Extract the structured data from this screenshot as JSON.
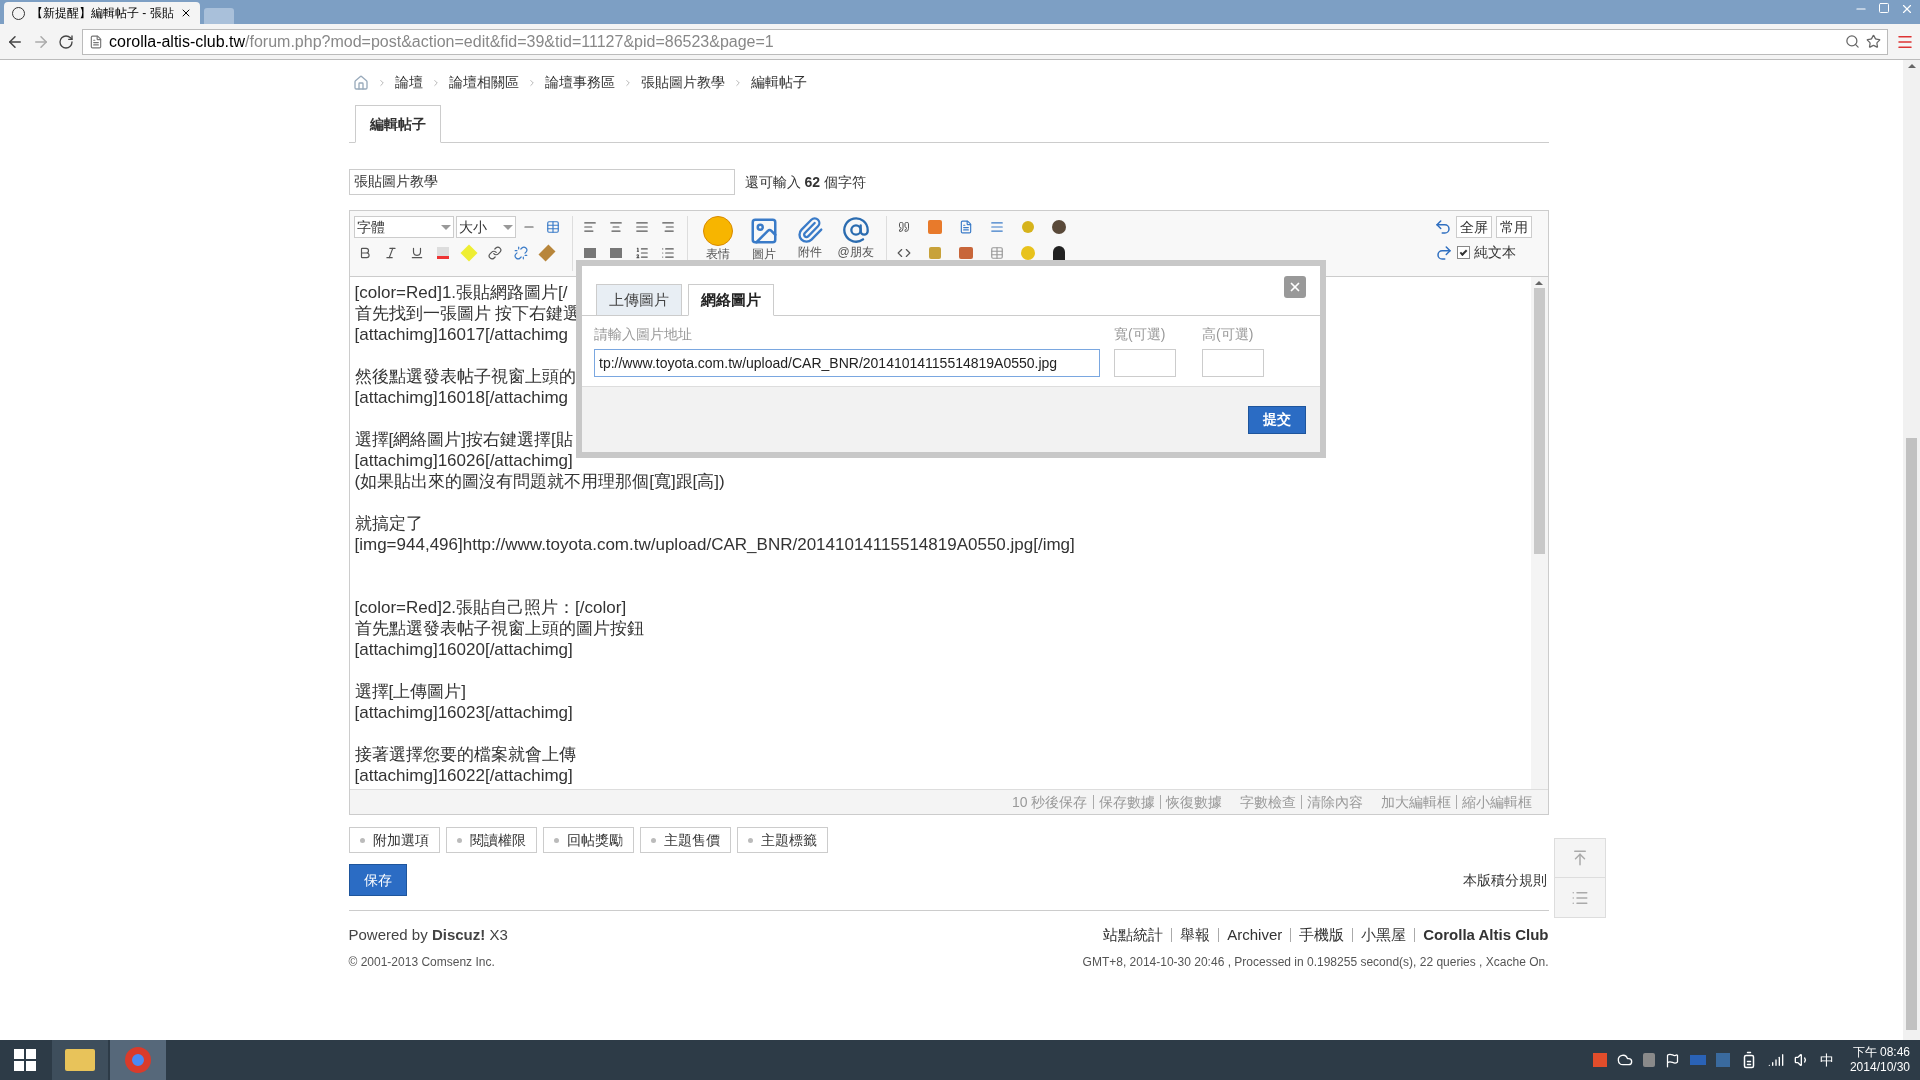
{
  "browser": {
    "tab_title": "【新提醒】編輯帖子 - 張貼",
    "url_host": "corolla-altis-club.tw",
    "url_path": "/forum.php?mod=post&action=edit&fid=39&tid=11127&pid=86523&page=1"
  },
  "breadcrumb": [
    "論壇",
    "論壇相關區",
    "論壇事務區",
    "張貼圖片教學",
    "編輯帖子"
  ],
  "page_tab": "編輯帖子",
  "subject": {
    "value": "張貼圖片教學",
    "remaining": "還可輸入 **62** 個字符"
  },
  "toolbar": {
    "font_select": "字體",
    "size_select": "大小",
    "big_buttons": [
      {
        "kind": "emoji",
        "label": "表情"
      },
      {
        "kind": "image",
        "label": "圖片"
      },
      {
        "kind": "clip",
        "label": "附件"
      },
      {
        "kind": "at",
        "label": "@朋友"
      }
    ],
    "fullscreen": "全屏",
    "common": "常用",
    "plain_text": {
      "label": "純文本",
      "checked": true
    }
  },
  "editor": {
    "sections": [
      {
        "paragraphs": [
          [
            "[color=Red]1.張貼網路圖片[/",
            "首先找到一張圖片 按下右鍵選",
            "[attachimg]16017[/attachimg"
          ],
          [
            "然後點選發表帖子視窗上頭的",
            "[attachimg]16018[/attachimg"
          ],
          [
            "選擇[網絡圖片]按右鍵選擇[貼",
            "[attachimg]16026[/attachimg]",
            "(如果貼出來的圖沒有問題就不用理那個[寬]跟[高])"
          ],
          [
            "就搞定了",
            "[img=944,496]http://www.toyota.com.tw/upload/CAR_BNR/20141014115514819A0550.jpg[/img]"
          ]
        ]
      },
      {
        "paragraphs": [
          [
            "[color=Red]2.張貼自己照片：[/color]",
            "首先點選發表帖子視窗上頭的圖片按鈕",
            "[attachimg]16020[/attachimg]"
          ],
          [
            "選擇[上傳圖片]",
            "[attachimg]16023[/attachimg]"
          ],
          [
            "接著選擇您要的檔案就會上傳",
            "[attachimg]16022[/attachimg]"
          ]
        ]
      }
    ]
  },
  "dialog": {
    "tabs": [
      {
        "label": "上傳圖片",
        "selected": false
      },
      {
        "label": "網絡圖片",
        "selected": true
      }
    ],
    "url_label": "請輸入圖片地址",
    "url_value": "tp://www.toyota.com.tw/upload/CAR_BNR/20141014115514819A0550.jpg",
    "width_label": "寬(可選)",
    "height_label": "高(可選)",
    "submit": "提交"
  },
  "status_links": [
    [
      "10 秒後保存",
      "保存數據",
      "恢復數據"
    ],
    [
      "字數檢查",
      "清除內容"
    ],
    [
      "加大編輯框",
      "縮小編輯框"
    ]
  ],
  "option_tabs": [
    "附加選項",
    "閱讀權限",
    "回帖獎勵",
    "主題售價",
    "主題標籤"
  ],
  "save": "保存",
  "rules": "本版積分規則",
  "footer": {
    "powered": "Powered by **Discuz!** X3",
    "copyright": "© 2001-2013 Comsenz Inc.",
    "links": [
      {
        "label": "站點統計",
        "bold": false
      },
      {
        "label": "舉報",
        "bold": false
      },
      {
        "label": "Archiver",
        "bold": false
      },
      {
        "label": "手機版",
        "bold": false
      },
      {
        "label": "小黑屋",
        "bold": false
      },
      {
        "label": "Corolla Altis Club",
        "bold": true
      }
    ],
    "info": "GMT+8, 2014-10-30 20:46 , Processed in 0.198255 second(s), 22 queries , Xcache On."
  },
  "taskbar": {
    "ime": "中",
    "time": "下午 08:46",
    "date": "2014/10/30"
  }
}
